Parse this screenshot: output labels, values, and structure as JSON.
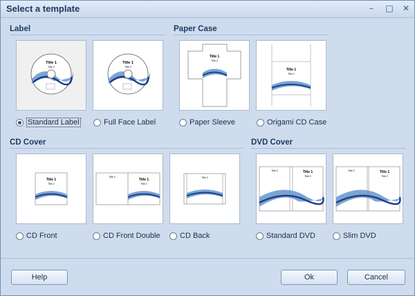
{
  "window": {
    "title": "Select a template",
    "minimize_icon": "minimize-icon",
    "maximize_icon": "maximize-icon",
    "close_icon": "close-icon"
  },
  "sections": {
    "label": "Label",
    "paper_case": "Paper Case",
    "cd_cover": "CD Cover",
    "dvd_cover": "DVD Cover"
  },
  "preview_text": {
    "title1": "Title 1",
    "title2": "Title 2"
  },
  "options": {
    "standard_label": "Standard Label",
    "full_face_label": "Full Face Label",
    "paper_sleeve": "Paper Sleeve",
    "origami_cd_case": "Origami CD Case",
    "cd_front": "CD Front",
    "cd_front_double": "CD Front Double",
    "cd_back": "CD Back",
    "standard_dvd": "Standard DVD",
    "slim_dvd": "Slim DVD"
  },
  "selected": "standard_label",
  "buttons": {
    "help": "Help",
    "ok": "Ok",
    "cancel": "Cancel"
  },
  "colors": {
    "accent": "#2a4f8a",
    "window_bg": "#cfdcee",
    "title_text": "#1e3a62"
  }
}
